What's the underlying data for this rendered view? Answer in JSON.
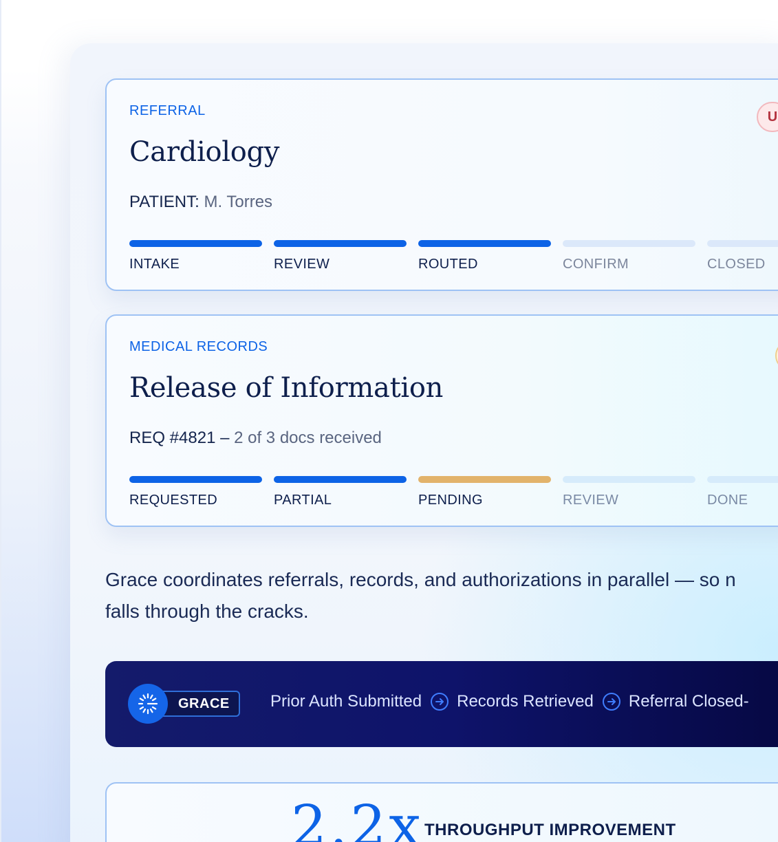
{
  "referral_card": {
    "kicker": "REFERRAL",
    "title": "Cardiology",
    "meta_label": "PATIENT:",
    "meta_value": "M. Torres",
    "badge": "U",
    "steps": [
      "INTAKE",
      "REVIEW",
      "ROUTED",
      "CONFIRM",
      "CLOSED"
    ],
    "steps_complete": 3
  },
  "records_card": {
    "kicker": "MEDICAL RECORDS",
    "title": "Release of Information",
    "meta_label": "REQ #4821 –",
    "meta_value": "2 of 3 docs received",
    "steps": [
      "REQUESTED",
      "PARTIAL",
      "PENDING",
      "REVIEW",
      "DONE"
    ],
    "steps_complete": 2,
    "steps_pending": 1
  },
  "description": {
    "line1": "Grace coordinates referrals, records, and authorizations in parallel — so n",
    "line2": "falls through the cracks."
  },
  "activity": {
    "agent": "GRACE",
    "events": [
      "Prior Auth Submitted",
      "Records Retrieved",
      "Referral Closed-"
    ]
  },
  "stat": {
    "value": "2.2x",
    "label": "THROUGHPUT IMPROVEMENT"
  },
  "colors": {
    "accent": "#0d63e6",
    "navy": "#0e1f4c",
    "pending": "#e2b36b",
    "urgent": "#b3333f"
  }
}
